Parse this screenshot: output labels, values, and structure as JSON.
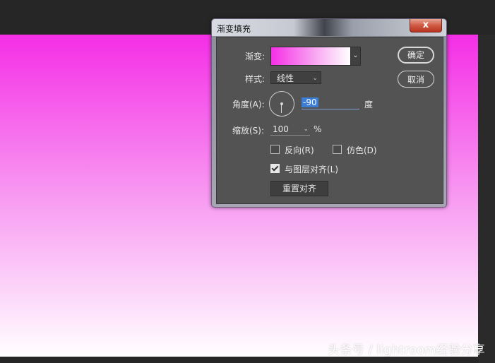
{
  "dialog": {
    "title": "渐变填充",
    "close_label": "x",
    "gradient_label": "渐变:",
    "style_label": "样式:",
    "style_value": "线性",
    "angle_label": "角度(A):",
    "angle_value": "-90",
    "angle_unit": "度",
    "scale_label": "缩放(S):",
    "scale_value": "100",
    "scale_unit": "%",
    "reverse_label": "反向(R)",
    "reverse_checked": false,
    "dither_label": "仿色(D)",
    "dither_checked": false,
    "align_label": "与图层对齐(L)",
    "align_checked": true,
    "reset_align_label": "重置对齐",
    "ok_label": "确定",
    "cancel_label": "取消"
  },
  "colors": {
    "gradient_start": "#f52ee6",
    "gradient_end": "#ffffff",
    "selection": "#3b7ed8"
  },
  "watermark": "头条号 / lightroom经验分享"
}
